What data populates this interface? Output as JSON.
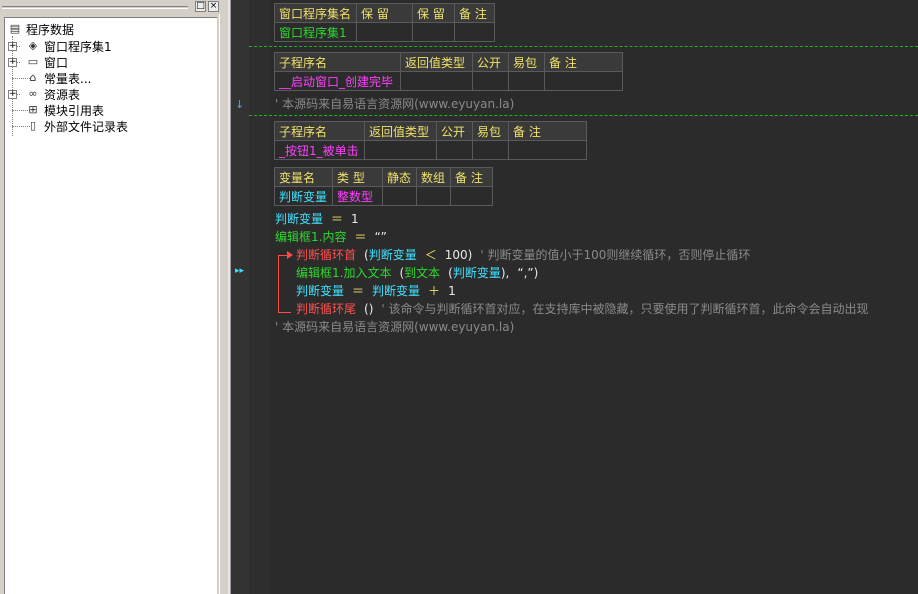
{
  "tree": {
    "root": "程序数据",
    "items": [
      {
        "label": "窗口程序集1",
        "icon": "stack-icon",
        "expander": "+"
      },
      {
        "label": "窗口",
        "icon": "window-icon",
        "expander": "+"
      },
      {
        "label": "常量表...",
        "icon": "constants-icon",
        "expander": ""
      },
      {
        "label": "资源表",
        "icon": "resource-icon",
        "expander": "+"
      },
      {
        "label": "模块引用表",
        "icon": "module-icon",
        "expander": ""
      },
      {
        "label": "外部文件记录表",
        "icon": "file-icon",
        "expander": ""
      }
    ],
    "pin_glyph": "□",
    "close_glyph": "×"
  },
  "assembly_table": {
    "headers": [
      "窗口程序集名",
      "保 留",
      "保 留",
      "备 注"
    ],
    "row": [
      "窗口程序集1",
      "",
      "",
      ""
    ]
  },
  "sub1_table": {
    "headers": [
      "子程序名",
      "返回值类型",
      "公开",
      "易包",
      "备 注"
    ],
    "row": [
      "__启动窗口_创建完毕",
      "",
      "",
      "",
      ""
    ]
  },
  "comment1": "' 本源码来自易语言资源网(www.eyuyan.la)",
  "sub2_table": {
    "headers": [
      "子程序名",
      "返回值类型",
      "公开",
      "易包",
      "备 注"
    ],
    "row": [
      "_按钮1_被单击",
      "",
      "",
      "",
      ""
    ]
  },
  "var_table": {
    "headers": [
      "变量名",
      "类 型",
      "静态",
      "数组",
      "备 注"
    ],
    "row": [
      "判断变量",
      "整数型",
      "",
      "",
      ""
    ]
  },
  "code": {
    "line1": {
      "lhs": "判断变量",
      "op": "＝",
      "rhs": "1"
    },
    "line2": {
      "lhs": "编辑框1.内容",
      "op": "＝",
      "rhs": "“”"
    },
    "line3": {
      "cmd": "判断循环首",
      "open": "(",
      "var": "判断变量",
      "op": "＜",
      "num": "100",
      "close": ")",
      "comment": "' 判断变量的值小于100则继续循环，否则停止循环"
    },
    "line4": {
      "obj": "编辑框1.加入文本",
      "open": "(",
      "fn": "到文本",
      "open2": "(",
      "var": "判断变量",
      "close2": ")",
      "comma": ",",
      "str": "“,”",
      "close": ")"
    },
    "line5": {
      "lhs": "判断变量",
      "op": "＝",
      "rhs": "判断变量",
      "plus": "＋",
      "num": "1"
    },
    "line6": {
      "cmd": "判断循环尾",
      "parens": "()",
      "comment": "' 该命令与判断循环首对应，在支持库中被隐藏，只要使用了判断循环首，此命令会自动出现"
    },
    "line7": "' 本源码来自易语言资源网(www.eyuyan.la)"
  },
  "gutter": {
    "down_arrow": "↓",
    "run_marker": "▸▸"
  }
}
